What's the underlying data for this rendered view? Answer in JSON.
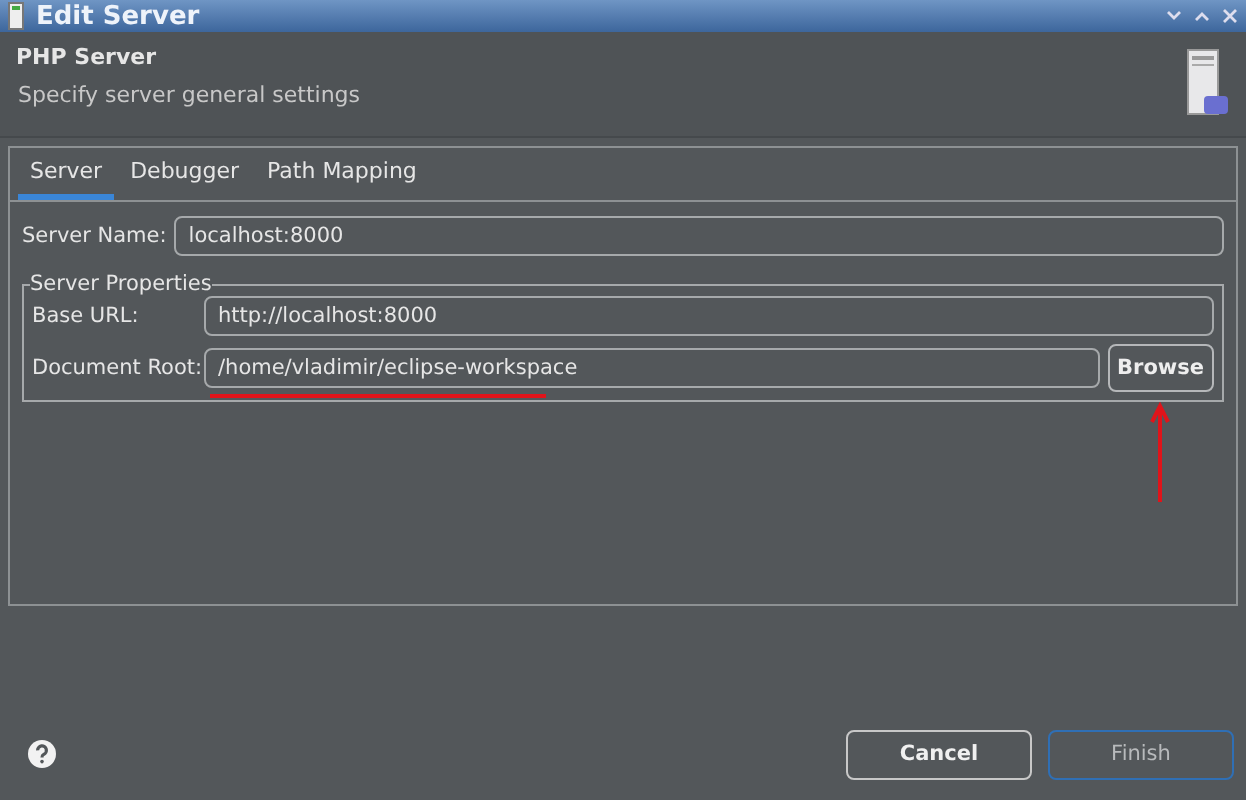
{
  "window": {
    "title": "Edit Server"
  },
  "header": {
    "title": "PHP Server",
    "subtitle": "Specify server general settings"
  },
  "tabs": [
    {
      "label": "Server",
      "selected": true
    },
    {
      "label": "Debugger",
      "selected": false
    },
    {
      "label": "Path Mapping",
      "selected": false
    }
  ],
  "server_name": {
    "label": "Server Name:",
    "value": "localhost:8000"
  },
  "server_properties": {
    "title": "Server Properties",
    "fields": [
      {
        "label": "Base URL:",
        "value": "http://localhost:8000",
        "annotated": false
      },
      {
        "label": "Document Root:",
        "value": "/home/vladimir/eclipse-workspace",
        "annotated": true,
        "button": "Browse"
      }
    ]
  },
  "buttons": [
    {
      "label": "Cancel",
      "disabled": false
    },
    {
      "label": "Finish",
      "disabled": true
    }
  ]
}
